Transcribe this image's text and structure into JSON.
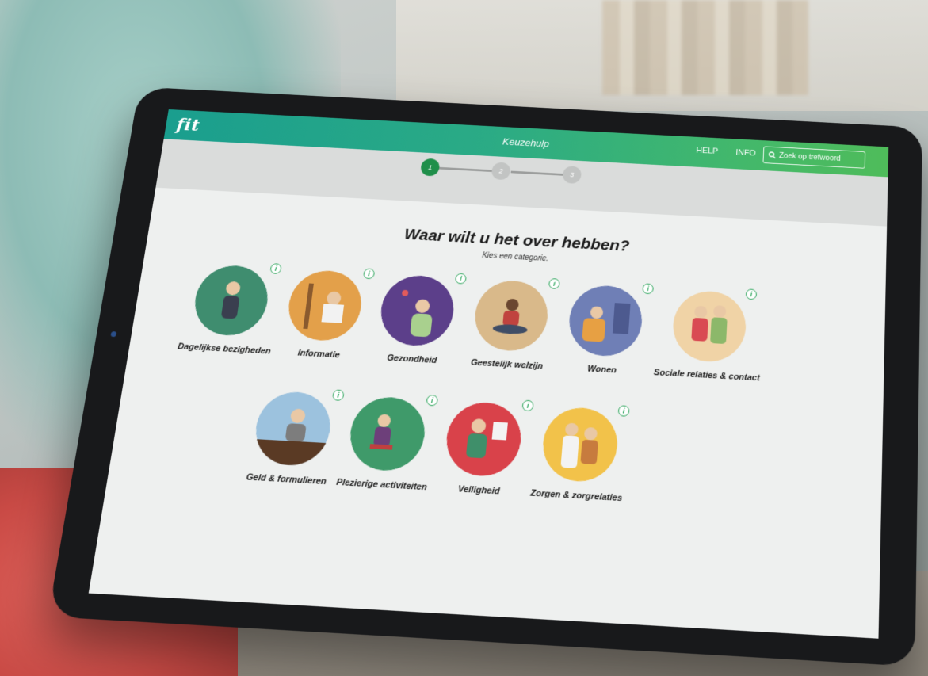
{
  "header": {
    "logo": "fit",
    "title": "Keuzehulp",
    "help_label": "HELP",
    "info_label": "INFO",
    "search_placeholder": "Zoek op trefwoord"
  },
  "stepper": {
    "steps": [
      "1",
      "2",
      "3"
    ],
    "active_step": 1
  },
  "main": {
    "heading": "Waar wilt u het over hebben?",
    "subheading": "Kies een categorie.",
    "categories": [
      {
        "label": "Dagelijkse bezigheden",
        "color": "#3f8d6f"
      },
      {
        "label": "Informatie",
        "color": "#e3a04a"
      },
      {
        "label": "Gezondheid",
        "color": "#5c3f8a"
      },
      {
        "label": "Geestelijk welzijn",
        "color": "#d9b98a"
      },
      {
        "label": "Wonen",
        "color": "#6f7fb6"
      },
      {
        "label": "Sociale relaties & contact",
        "color": "#f0d3a6"
      },
      {
        "label": "Geld & formulieren",
        "color": "#9cc2de"
      },
      {
        "label": "Plezierige activiteiten",
        "color": "#3f9a6a"
      },
      {
        "label": "Veiligheid",
        "color": "#d9424a"
      },
      {
        "label": "Zorgen & zorgrelaties",
        "color": "#f2c24a"
      }
    ],
    "info_glyph": "i"
  }
}
